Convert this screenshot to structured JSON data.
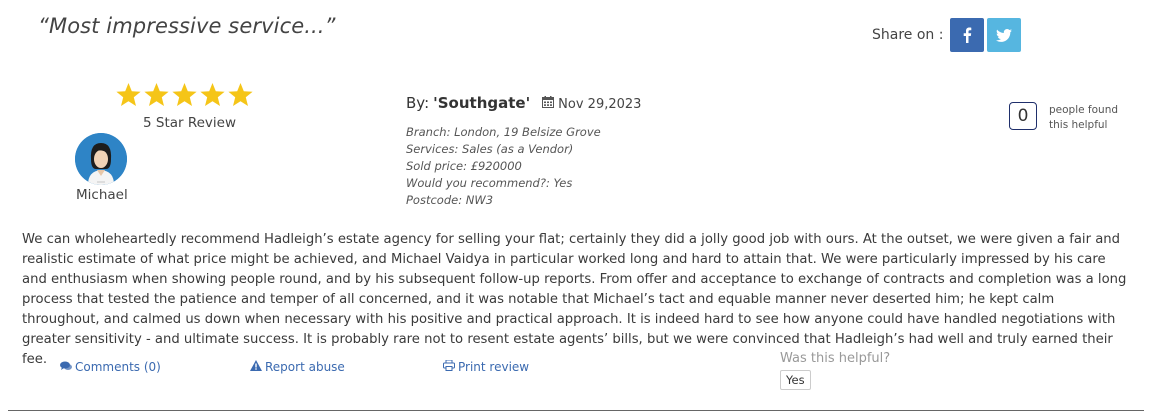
{
  "review": {
    "headline": "“Most impressive service...”",
    "rating": {
      "stars": 5,
      "max": 5,
      "caption": "5 Star Review",
      "color": "#f5c518"
    },
    "reviewer": {
      "name": "Michael",
      "avatar_icon": "person-avatar-icon"
    },
    "by_label": "By:",
    "author": "'Southgate'",
    "date": "Nov 29,2023",
    "details": [
      "Branch: London, 19 Belsize Grove",
      "Services: Sales (as a Vendor)",
      "Sold price: £920000",
      "Would you recommend?: Yes",
      "Postcode: NW3"
    ],
    "helpful_count": "0",
    "helpful_text_line1": "people found",
    "helpful_text_line2": "this helpful",
    "body": "We can wholeheartedly recommend Hadleigh’s estate agency for selling your flat; certainly they did a jolly good job with ours. At the outset, we were given a fair and realistic estimate of what price might be achieved, and Michael Vaidya in particular worked long and hard to attain that. We were particularly impressed by his care and enthusiasm when showing people round, and by his subsequent follow-up reports. From offer and acceptance to exchange of contracts and completion was a long process that tested the patience and temper of all concerned, and it was notable that Michael’s tact and equable manner never deserted him; he kept calm throughout, and calmed us down when necessary with his positive and practical approach. It is indeed hard to see how anyone could have handled negotiations with greater sensitivity - and ultimate success. It is probably rare not to resent estate agents’ bills, but we were convinced that Hadleigh’s had well and truly earned their fee."
  },
  "share": {
    "label": "Share on :",
    "facebook_icon": "facebook-icon",
    "twitter_icon": "twitter-icon",
    "facebook_color": "#3b6ab0",
    "twitter_color": "#56b6e0"
  },
  "actions": {
    "comments": "Comments (0)",
    "report": "Report abuse",
    "print": "Print review",
    "was_helpful": "Was this helpful?",
    "yes": "Yes"
  }
}
